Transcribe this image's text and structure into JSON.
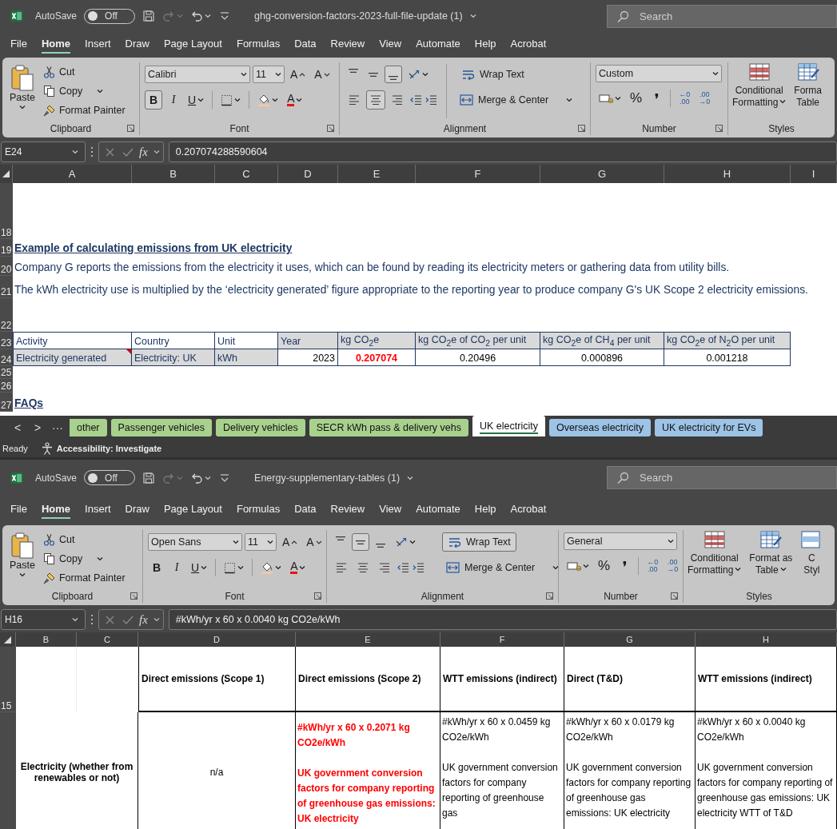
{
  "windows": [
    {
      "autosave": {
        "label": "AutoSave",
        "state": "Off",
        "on": false
      },
      "title": "ghg-conversion-factors-2023-full-file-update (1)",
      "search": {
        "placeholder": "Search"
      },
      "menu": [
        {
          "label": "File",
          "selected": false
        },
        {
          "label": "Home",
          "selected": true
        },
        {
          "label": "Insert",
          "selected": false
        },
        {
          "label": "Draw",
          "selected": false
        },
        {
          "label": "Page Layout",
          "selected": false
        },
        {
          "label": "Formulas",
          "selected": false
        },
        {
          "label": "Data",
          "selected": false
        },
        {
          "label": "Review",
          "selected": false
        },
        {
          "label": "View",
          "selected": false
        },
        {
          "label": "Automate",
          "selected": false
        },
        {
          "label": "Help",
          "selected": false
        },
        {
          "label": "Acrobat",
          "selected": false
        }
      ],
      "ribbon": {
        "clipboard": {
          "label": "Clipboard",
          "paste": "Paste",
          "cut": "Cut",
          "copy": "Copy",
          "format_painter": "Format Painter"
        },
        "font": {
          "label": "Font",
          "name": "Calibri",
          "size": "11",
          "grow": "A",
          "shrink": "A",
          "bold": {
            "text": "B",
            "selected": true
          },
          "italic": "I",
          "underline": "U",
          "font_color": "A"
        },
        "alignment": {
          "label": "Alignment",
          "vertical": [
            {
              "selected": false
            },
            {
              "selected": false
            },
            {
              "selected": true
            }
          ],
          "horizontal": [
            {
              "selected": false
            },
            {
              "selected": true
            },
            {
              "selected": false
            }
          ],
          "wrap_text": {
            "text": "Wrap Text",
            "selected": false
          },
          "merge": "Merge & Center"
        },
        "number": {
          "label": "Number",
          "format": "Custom",
          "percent": "%",
          "comma": "❜",
          "increase_decimal": [
            "←0",
            ".00"
          ],
          "decrease_decimal": [
            ".00",
            "→0"
          ]
        },
        "styles": {
          "label": "Styles",
          "buttons": [
            {
              "kind": "conditional",
              "lines": [
                "Conditional",
                "Formatting"
              ],
              "dropdown": true
            },
            {
              "kind": "table",
              "lines": [
                "Forma",
                "Table"
              ],
              "dropdown": false
            }
          ]
        }
      },
      "formula_bar": {
        "name_box": "E24",
        "function_label": "fx",
        "formula": "0.207074288590604"
      },
      "sheet": {
        "columns": [
          "A",
          "B",
          "C",
          "D",
          "E",
          "F",
          "G",
          "H",
          "I"
        ],
        "rows": [
          {
            "number": "18",
            "kind": "blank"
          },
          {
            "number": "19",
            "kind": "heading",
            "text": "Example of calculating emissions from UK electricity"
          },
          {
            "number": "20",
            "kind": "note",
            "text": "Company G reports the emissions from the electricity it uses, which can be found by reading its electricity meters or gathering data from utility bills."
          },
          {
            "number": "21",
            "kind": "note",
            "text": "The kWh electricity use is multiplied by the ‘electricity generated’ figure appropriate to the reporting year to produce company G's UK Scope 2 electricity emissions."
          },
          {
            "number": "22",
            "kind": "blank"
          },
          {
            "number": "23",
            "kind": "table-header",
            "cells": [
              {
                "text": "Activity",
                "shaded": false
              },
              {
                "text": "Country",
                "shaded": false
              },
              {
                "text": "Unit",
                "shaded": false
              },
              {
                "text": "Year",
                "shaded": true
              },
              {
                "text": "kg CO$_{2}$e",
                "shaded": true
              },
              {
                "text": "kg CO$_{2}$e of CO$_{2}$ per unit",
                "shaded": true
              },
              {
                "text": "kg CO$_{2}$e of CH$_{4}$ per unit",
                "shaded": true
              },
              {
                "text": "kg CO$_{2}$e of N$_{2}$O per unit",
                "shaded": true
              }
            ]
          },
          {
            "number": "24",
            "kind": "table-row",
            "cells": [
              {
                "text": "Electricity generated",
                "kind": "text",
                "shaded": true,
                "comment": true
              },
              {
                "text": "Electricity: UK",
                "kind": "text",
                "shaded": true,
                "comment": false
              },
              {
                "text": "kWh",
                "kind": "text",
                "shaded": true,
                "comment": false
              },
              {
                "text": "2023",
                "kind": "number",
                "shaded": false,
                "comment": false
              },
              {
                "text": "0.207074",
                "kind": "result",
                "shaded": false,
                "comment": false
              },
              {
                "text": "0.20496",
                "kind": "factor",
                "shaded": false,
                "comment": false
              },
              {
                "text": "0.000896",
                "kind": "factor",
                "shaded": false,
                "comment": false
              },
              {
                "text": "0.001218",
                "kind": "factor",
                "shaded": false,
                "comment": false
              }
            ]
          },
          {
            "number": "25",
            "kind": "blank"
          },
          {
            "number": "26",
            "kind": "blank"
          },
          {
            "number": "27",
            "kind": "heading",
            "text": "FAQs"
          }
        ]
      },
      "sheet_tabs": {
        "nav": [
          "<",
          ">",
          "···"
        ],
        "tabs": [
          {
            "label": "other",
            "color": "#a9d18e",
            "selected": false
          },
          {
            "label": "Passenger vehicles",
            "color": "#a9d18e",
            "selected": false
          },
          {
            "label": "Delivery vehicles",
            "color": "#a9d18e",
            "selected": false
          },
          {
            "label": "SECR kWh pass & delivery vehs",
            "color": "#a9d18e",
            "selected": false
          },
          {
            "label": "UK electricity",
            "color": "#217346",
            "selected": true
          },
          {
            "label": "Overseas electricity",
            "color": "#9dc3e6",
            "selected": false
          },
          {
            "label": "UK electricity for EVs",
            "color": "#9dc3e6",
            "selected": false
          }
        ]
      },
      "status_bar": {
        "mode": "Ready",
        "accessibility": "Accessibility: Investigate"
      }
    },
    {
      "autosave": {
        "label": "AutoSave",
        "state": "Off",
        "on": false
      },
      "title": "Energy-supplementary-tables (1)",
      "search": {
        "placeholder": "Search"
      },
      "menu": [
        {
          "label": "File",
          "selected": false
        },
        {
          "label": "Home",
          "selected": true
        },
        {
          "label": "Insert",
          "selected": false
        },
        {
          "label": "Draw",
          "selected": false
        },
        {
          "label": "Page Layout",
          "selected": false
        },
        {
          "label": "Formulas",
          "selected": false
        },
        {
          "label": "Data",
          "selected": false
        },
        {
          "label": "Review",
          "selected": false
        },
        {
          "label": "View",
          "selected": false
        },
        {
          "label": "Automate",
          "selected": false
        },
        {
          "label": "Help",
          "selected": false
        },
        {
          "label": "Acrobat",
          "selected": false
        }
      ],
      "ribbon": {
        "clipboard": {
          "label": "Clipboard",
          "paste": "Paste",
          "cut": "Cut",
          "copy": "Copy",
          "format_painter": "Format Painter"
        },
        "font": {
          "label": "Font",
          "name": "Open Sans",
          "size": "11",
          "grow": "A",
          "shrink": "A",
          "bold": {
            "text": "B",
            "selected": false
          },
          "italic": "I",
          "underline": "U",
          "font_color": "A"
        },
        "alignment": {
          "label": "Alignment",
          "vertical": [
            {
              "selected": false
            },
            {
              "selected": true
            },
            {
              "selected": false
            }
          ],
          "horizontal": [
            {
              "selected": false
            },
            {
              "selected": false
            },
            {
              "selected": false
            }
          ],
          "wrap_text": {
            "text": "Wrap Text",
            "selected": true
          },
          "merge": "Merge & Center"
        },
        "number": {
          "label": "Number",
          "format": "General",
          "percent": "%",
          "comma": "❜",
          "increase_decimal": [
            "←0",
            ".00"
          ],
          "decrease_decimal": [
            ".00",
            "→0"
          ]
        },
        "styles": {
          "label": "Styles",
          "buttons": [
            {
              "kind": "conditional",
              "lines": [
                "Conditional",
                "Formatting"
              ],
              "dropdown": true
            },
            {
              "kind": "table",
              "lines": [
                "Format as",
                "Table"
              ],
              "dropdown": true
            },
            {
              "kind": "cell",
              "lines": [
                "C",
                "Styl"
              ],
              "dropdown": false
            }
          ]
        }
      },
      "formula_bar": {
        "name_box": "H16",
        "function_label": "fx",
        "formula": "#kWh/yr x 60 x 0.0040 kg CO2e/kWh"
      },
      "sheet": {
        "columns": [
          "B",
          "C",
          "D",
          "E",
          "F",
          "G",
          "H"
        ],
        "rows": [
          {
            "number": "15",
            "kind": "column-heads",
            "cells": [
              {
                "text": ""
              },
              {
                "text": ""
              },
              {
                "text": "Direct emissions (Scope 1)"
              },
              {
                "text": "Direct emissions (Scope 2)"
              },
              {
                "text": "WTT emissions (indirect)"
              },
              {
                "text": "Direct (T&D)"
              },
              {
                "text": "WTT emissions (indirect)"
              }
            ]
          },
          {
            "kind": "matrix-row",
            "cells": [
              {
                "kind": "label",
                "paragraphs": [
                  "Electricity (whether from renewables or not)"
                ]
              },
              {
                "text": ""
              },
              {
                "kind": "na",
                "paragraphs": [
                  "n/a"
                ]
              },
              {
                "kind": "highlight",
                "paragraphs": [
                  "#kWh/yr x 60 x 0.2071 kg CO2e/kWh",
                  "UK government conversion factors for company reporting of greenhouse gas emissions: UK electricity"
                ]
              },
              {
                "kind": "plain",
                "paragraphs": [
                  "#kWh/yr x 60 x 0.0459 kg CO2e/kWh",
                  "UK government conversion factors for company reporting of greenhouse gas"
                ]
              },
              {
                "kind": "plain",
                "paragraphs": [
                  "#kWh/yr x 60 x 0.0179 kg CO2e/kWh",
                  "UK government conversion factors for company reporting of greenhouse gas emissions: UK electricity"
                ]
              },
              {
                "kind": "plain",
                "paragraphs": [
                  "#kWh/yr x 60 x 0.0040 kg CO2e/kWh",
                  "UK government conversion factors for company reporting of greenhouse gas emissions: UK electricity WTT of T&D"
                ]
              }
            ]
          }
        ]
      }
    }
  ]
}
